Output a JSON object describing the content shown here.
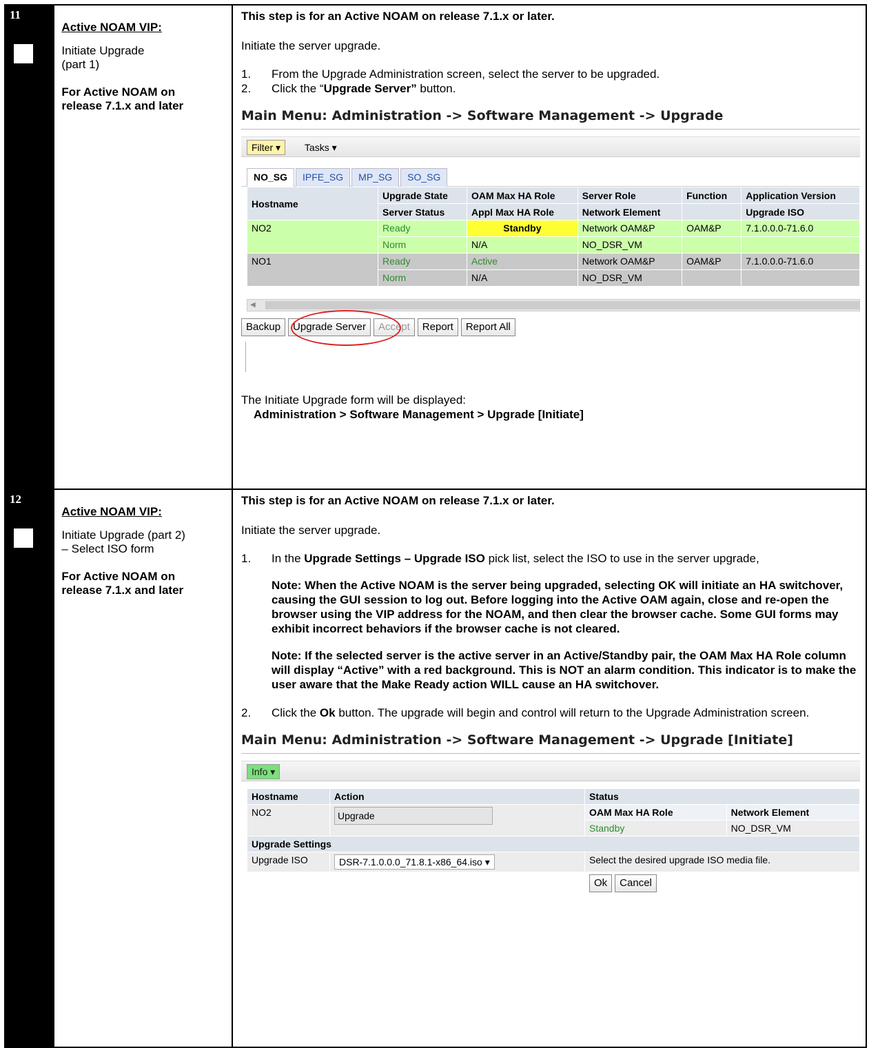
{
  "step11": {
    "number": "11",
    "title_head": "Active NOAM VIP:",
    "title_line1": "Initiate Upgrade",
    "title_line2": "(part 1)",
    "title_bold1": "For Active NOAM on",
    "title_bold2": "release 7.1.x and later",
    "heading": "This step is for an Active NOAM on release 7.1.x or later.",
    "intro": "Initiate the server upgrade.",
    "item1_num": "1.",
    "item1_text": "From the Upgrade Administration screen, select the server to be upgraded.",
    "item2_num": "2.",
    "item2_pre": "Click the “",
    "item2_bold": "Upgrade Server”",
    "item2_post": " button.",
    "menu_title": "Main Menu: Administration -> Software Management -> Upgrade",
    "filter_label": "Filter ▾",
    "tasks_label": "Tasks ▾",
    "tabs": [
      "NO_SG",
      "IPFE_SG",
      "MP_SG",
      "SO_SG"
    ],
    "table": {
      "hostname_header": "Hostname",
      "headers_row1": [
        "Upgrade State",
        "OAM Max HA Role",
        "Server Role",
        "Function",
        "Application Version"
      ],
      "headers_row2": [
        "Server Status",
        "Appl Max HA Role",
        "Network Element",
        "",
        "Upgrade ISO"
      ],
      "rows": [
        {
          "hostname": "NO2",
          "upgrade_state": "Ready",
          "oam_role": "Standby",
          "server_role": "Network OAM&P",
          "function": "OAM&P",
          "version": "7.1.0.0.0-71.6.0",
          "server_status": "Norm",
          "appl_role": "N/A",
          "network_element": "NO_DSR_VM",
          "upgrade_iso": ""
        },
        {
          "hostname": "NO1",
          "upgrade_state": "Ready",
          "oam_role": "Active",
          "server_role": "Network OAM&P",
          "function": "OAM&P",
          "version": "7.1.0.0.0-71.6.0",
          "server_status": "Norm",
          "appl_role": "N/A",
          "network_element": "NO_DSR_VM",
          "upgrade_iso": ""
        }
      ]
    },
    "buttons": [
      "Backup",
      "Upgrade Server",
      "Accept",
      "Report",
      "Report All"
    ],
    "footer_line1": "The Initiate Upgrade form will be displayed:",
    "footer_line2": "Administration  > Software Management  > Upgrade [Initiate]"
  },
  "step12": {
    "number": "12",
    "title_head": "Active NOAM VIP:",
    "title_line1": "Initiate Upgrade (part 2)",
    "title_line2": "– Select ISO form",
    "title_bold1": "For Active NOAM on",
    "title_bold2": "release 7.1.x and later",
    "heading": "This step is for an Active NOAM on release 7.1.x or later.",
    "intro": "Initiate the server upgrade.",
    "item1_num": "1.",
    "item1_pre": "In the ",
    "item1_bold": "Upgrade Settings – Upgrade ISO",
    "item1_post": " pick list, select the ISO to use in the server upgrade,",
    "note1": "Note: When the Active NOAM is the server being upgraded, selecting OK will initiate an HA switchover, causing the GUI session to log out. Before logging into the Active OAM again, close and re-open the browser using the VIP address for the NOAM, and then clear the browser cache. Some GUI forms may exhibit incorrect behaviors if the browser cache is not cleared.",
    "note2": "Note: If the selected server is the active server in an Active/Standby pair, the OAM Max HA Role column will display “Active” with a red background. This is NOT an alarm condition. This indicator is to make the user aware that the Make Ready action WILL cause an HA switchover.",
    "item2_num": "2.",
    "item2_pre": "Click the ",
    "item2_bold": "Ok",
    "item2_post": " button. The upgrade will begin and control will return to the Upgrade Administration screen.",
    "menu_title": "Main Menu: Administration -> Software Management -> Upgrade [Initiate]",
    "info_label": "Info ▾",
    "form": {
      "hostname_header": "Hostname",
      "action_header": "Action",
      "status_header": "Status",
      "status_sub1": "OAM Max HA Role",
      "status_sub2": "Network Element",
      "hostname": "NO2",
      "action": "Upgrade",
      "oam_role": "Standby",
      "network_element": "NO_DSR_VM",
      "settings_header": "Upgrade Settings",
      "iso_label": "Upgrade ISO",
      "iso_value": "DSR-7.1.0.0.0_71.8.1-x86_64.iso ▾",
      "iso_help": "Select the desired upgrade ISO media file.",
      "ok": "Ok",
      "cancel": "Cancel"
    }
  }
}
